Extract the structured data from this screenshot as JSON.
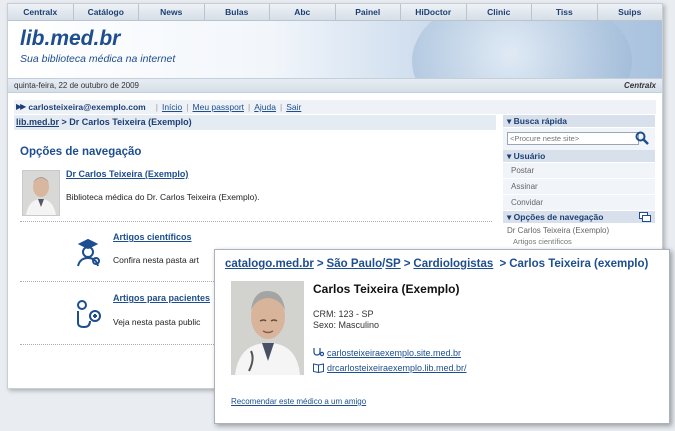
{
  "topnav": [
    "Centralx",
    "Catálogo",
    "News",
    "Bulas",
    "Abc",
    "Painel",
    "HiDoctor",
    "Clinic",
    "Tiss",
    "Suips"
  ],
  "banner": {
    "logo": "lib.med.br",
    "tagline": "Sua biblioteca médica na internet"
  },
  "datebar": {
    "date": "quinta-feira, 22 de outubro de 2009",
    "brand": "Centralx"
  },
  "userbar": {
    "email": "carlosteixeira@exemplo.com",
    "links": [
      "Início",
      "Meu passport",
      "Ajuda",
      "Sair"
    ]
  },
  "breadcrumb": {
    "root": "lib.med.br",
    "current": "> Dr Carlos Teixeira (Exemplo)"
  },
  "main": {
    "title": "Opções de navegação",
    "doctor_link": "Dr Carlos Teixeira (Exemplo)",
    "doctor_desc": "Biblioteca médica do Dr. Carlos Teixeira (Exemplo).",
    "categories": [
      {
        "title": "Artigos científicos",
        "desc": "Confira nesta pasta art"
      },
      {
        "title": "Artigos para pacientes",
        "desc": "Veja nesta pasta public"
      }
    ]
  },
  "sidebar": {
    "search_title": "Busca rápida",
    "search_placeholder": "<Procure neste site>",
    "user_title": "Usuário",
    "user_items": [
      "Postar",
      "Assinar",
      "Convidar"
    ],
    "nav_title": "Opções de navegação",
    "nav_items": [
      "Dr Carlos Teixeira (Exemplo)",
      "Artigos científicos"
    ]
  },
  "card": {
    "crumbs": {
      "site": "catalogo.med.br",
      "city": "São Paulo",
      "state": "SP",
      "specialty": "Cardiologistas",
      "current": "Carlos Teixeira (exemplo)"
    },
    "name": "Carlos Teixeira (Exemplo)",
    "crm": "CRM: 123 - SP",
    "sexo": "Sexo: Masculino",
    "link_site": "carlosteixeiraexemplo.site.med.br",
    "link_lib": "drcarlosteixeiraexemplo.lib.med.br/",
    "recommend": "Recomendar este médico a um amigo"
  }
}
